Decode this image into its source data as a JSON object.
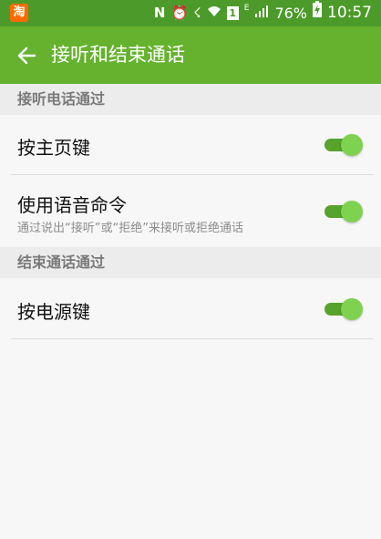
{
  "status_bar": {
    "app_icon_text": "淘",
    "battery_percent": "76%",
    "time": "10:57",
    "sim_badge": "1",
    "network_letter": "E"
  },
  "app_bar": {
    "title": "接听和结束通话"
  },
  "sections": [
    {
      "header": "接听电话通过",
      "items": [
        {
          "title": "按主页键",
          "subtitle": "",
          "enabled": true
        },
        {
          "title": "使用语音命令",
          "subtitle": "通过说出“接听”或“拒绝”来接听或拒绝通话",
          "enabled": true
        }
      ]
    },
    {
      "header": "结束通话通过",
      "items": [
        {
          "title": "按电源键",
          "subtitle": "",
          "enabled": true
        }
      ]
    }
  ],
  "colors": {
    "status_bar": "#4c9b2a",
    "app_bar": "#66b22f",
    "switch_track": "#57a32b",
    "switch_thumb": "#7ed24f"
  }
}
